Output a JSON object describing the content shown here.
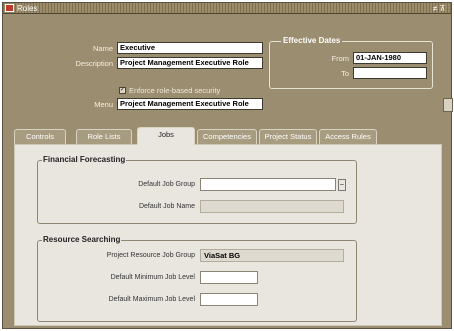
{
  "window": {
    "title": "Roles",
    "controls": "≠ ⊼"
  },
  "form": {
    "name_label": "Name",
    "name_value": "Executive",
    "description_label": "Description",
    "description_value": "Project Management Executive Role",
    "enforce_label": "Enforce role-based security",
    "enforce_checked": true,
    "menu_label": "Menu",
    "menu_value": "Project Management Executive Role"
  },
  "effective_dates": {
    "title": "Effective Dates",
    "from_label": "From",
    "from_value": "01-JAN-1980",
    "to_label": "To",
    "to_value": ""
  },
  "tabs": [
    {
      "label": "Controls",
      "active": false
    },
    {
      "label": "Role Lists",
      "active": false
    },
    {
      "label": "Jobs",
      "active": true
    },
    {
      "label": "Competencies",
      "active": false
    },
    {
      "label": "Project Status",
      "active": false
    },
    {
      "label": "Access Rules",
      "active": false
    }
  ],
  "financial_forecasting": {
    "title": "Financial Forecasting",
    "default_job_group_label": "Default Job Group",
    "default_job_group_value": "",
    "default_job_name_label": "Default Job Name",
    "default_job_name_value": ""
  },
  "resource_searching": {
    "title": "Resource Searching",
    "project_resource_job_group_label": "Project Resource Job Group",
    "project_resource_job_group_value": "ViaSat BG",
    "default_min_job_level_label": "Default Minimum Job Level",
    "default_min_job_level_value": "",
    "default_max_job_level_label": "Default Maximum Job Level",
    "default_max_job_level_value": ""
  },
  "colors": {
    "form_background": "#9b8d6f",
    "panel_background": "#e9e6e0",
    "title_icon": "#c0392b"
  }
}
